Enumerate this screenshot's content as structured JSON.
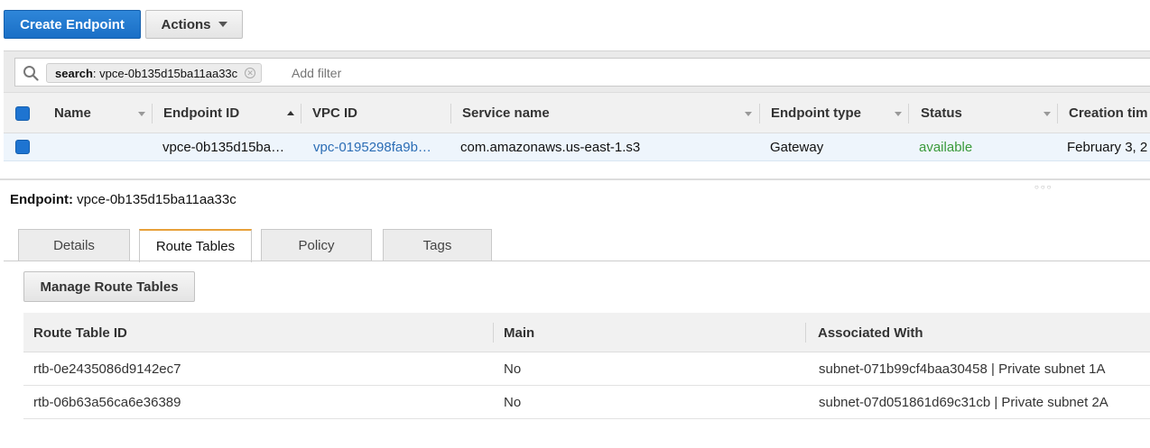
{
  "toolbar": {
    "create_label": "Create Endpoint",
    "actions_label": "Actions"
  },
  "filter": {
    "token_key": "search",
    "token_value": " : vpce-0b135d15ba11aa33c",
    "placeholder": "Add filter"
  },
  "grid": {
    "columns": [
      "Name",
      "Endpoint ID",
      "VPC ID",
      "Service name",
      "Endpoint type",
      "Status",
      "Creation tim"
    ],
    "rows": [
      {
        "name": "",
        "endpoint_id": "vpce-0b135d15ba…",
        "vpc_id": "vpc-0195298fa9b…",
        "service_name": "com.amazonaws.us-east-1.s3",
        "endpoint_type": "Gateway",
        "status": "available",
        "creation_time": "February 3, 2"
      }
    ]
  },
  "detail": {
    "endpoint_label": "Endpoint:",
    "endpoint_value": " vpce-0b135d15ba11aa33c",
    "tabs": [
      "Details",
      "Route Tables",
      "Policy",
      "Tags"
    ],
    "active_tab": "Route Tables",
    "manage_label": "Manage Route Tables"
  },
  "route_tables": {
    "columns": [
      "Route Table ID",
      "Main",
      "Associated With"
    ],
    "rows": [
      {
        "id": "rtb-0e2435086d9142ec7",
        "main": "No",
        "associated": "subnet-071b99cf4baa30458 | Private subnet 1A"
      },
      {
        "id": "rtb-06b63a56ca6e36389",
        "main": "No",
        "associated": "subnet-07d051861d69c31cb | Private subnet 2A"
      }
    ]
  },
  "colors": {
    "primary": "#1a6fc6",
    "link": "#2b6db5",
    "status_available": "#3a9a3a",
    "tab_accent": "#e8a13a"
  }
}
